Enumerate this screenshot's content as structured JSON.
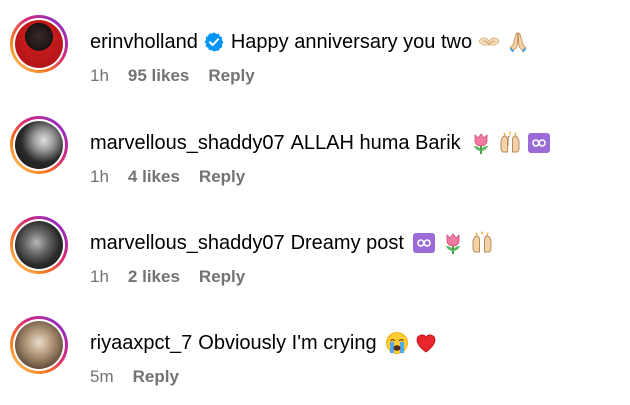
{
  "comments": [
    {
      "username": "erinvholland",
      "verified": true,
      "text": "Happy anniversary you two",
      "emojis": [
        "handshake-heart-icon",
        "folded-hands-icon"
      ],
      "time": "1h",
      "likes": "95 likes",
      "reply": "Reply"
    },
    {
      "username": "marvellous_shaddy07",
      "verified": false,
      "text": "ALLAH huma Barik",
      "emojis": [
        "tulip-icon",
        "raising-hands-icon",
        "infinity-icon"
      ],
      "time": "1h",
      "likes": "4 likes",
      "reply": "Reply"
    },
    {
      "username": "marvellous_shaddy07",
      "verified": false,
      "text": "Dreamy post",
      "emojis": [
        "infinity-icon",
        "tulip-icon",
        "raising-hands-icon"
      ],
      "time": "1h",
      "likes": "2 likes",
      "reply": "Reply"
    },
    {
      "username": "riyaaxpct_7",
      "verified": false,
      "text": "Obviously I'm crying",
      "emojis": [
        "crying-face-icon",
        "red-heart-icon"
      ],
      "time": "5m",
      "likes": "",
      "reply": "Reply"
    }
  ],
  "colors": {
    "text": "#000000",
    "meta": "#737373",
    "verified": "#0095f6",
    "story_ring": [
      "#feda75",
      "#fa7e1e",
      "#d62976",
      "#962fbf",
      "#4f5bd5"
    ]
  }
}
